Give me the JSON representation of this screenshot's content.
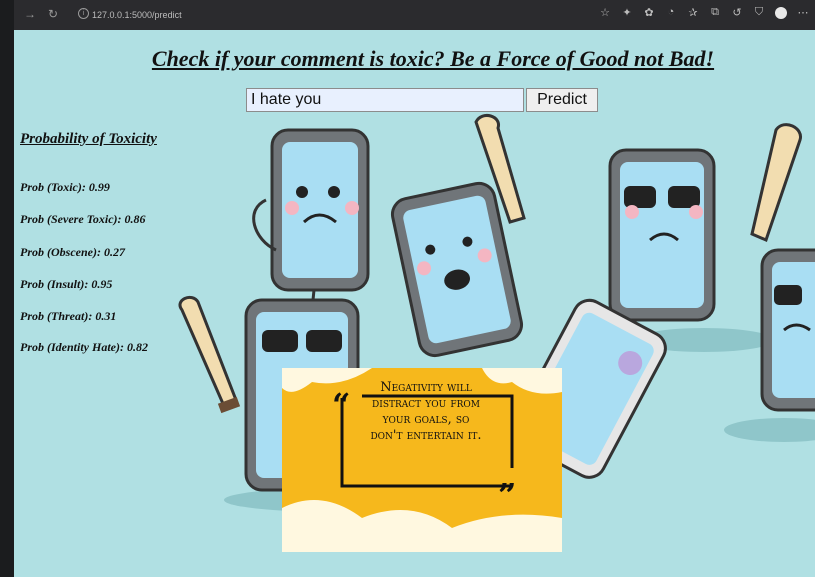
{
  "browser": {
    "url": "127.0.0.1:5000/predict",
    "icons": [
      "back-icon",
      "reload-icon",
      "info-icon",
      "star-icon",
      "puzzle-icon",
      "extension-icon",
      "collections-icon",
      "favorites-icon",
      "tabs-icon",
      "history-icon",
      "shield-icon",
      "profile-avatar",
      "more-icon"
    ]
  },
  "page": {
    "title": "Check if your comment is toxic? Be a Force of Good not Bad!",
    "input_value": "I hate you",
    "predict_label": "Predict"
  },
  "results": {
    "heading": "Probability of Toxicity",
    "items": [
      {
        "label": "Prob (Toxic): 0.99"
      },
      {
        "label": "Prob (Severe Toxic): 0.86"
      },
      {
        "label": "Prob (Obscene): 0.27"
      },
      {
        "label": "Prob (Insult): 0.95"
      },
      {
        "label": "Prob (Threat): 0.31"
      },
      {
        "label": "Prob (Identity Hate): 0.82"
      }
    ]
  },
  "quote": {
    "line1": "Negativity will",
    "line2": "distract you from",
    "line3": "your goals, so",
    "line4": "don't entertain it."
  },
  "colors": {
    "background": "#b0e0e3",
    "quote_bg": "#f6b81c",
    "phone_body": "#707579",
    "phone_screen": "#a9def3"
  }
}
